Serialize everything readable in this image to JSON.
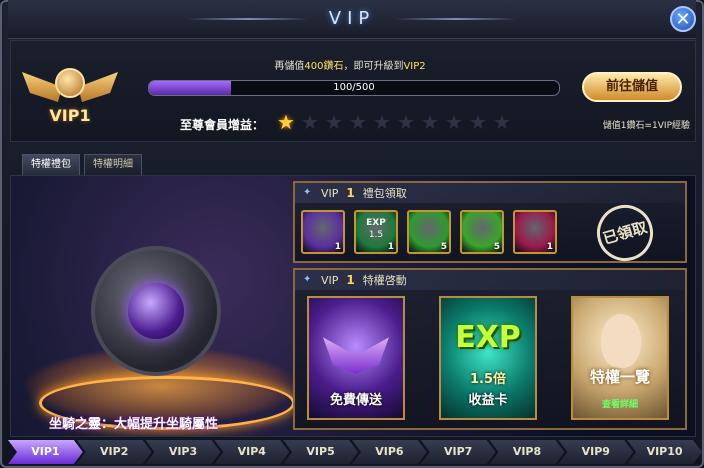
{
  "window": {
    "title": "VIP",
    "close_symbol": "✕"
  },
  "status": {
    "current_level": "VIP1",
    "hint_prefix": "再儲值",
    "hint_amount": "400鑽石",
    "hint_mid": "，即可升級到",
    "hint_target": "VIP2",
    "progress_text": "100/500",
    "progress_fraction": 0.2,
    "recharge_label": "前往儲值",
    "rate_note": "儲值1鑽石=1VIP經驗",
    "benefit_label": "至尊會員增益：",
    "stars_total": 10,
    "stars_lit": 1
  },
  "tabs": [
    {
      "label": "特權禮包",
      "active": true
    },
    {
      "label": "特權明細",
      "active": false
    }
  ],
  "stage": {
    "caption": "坐騎之靈：大幅提升坐騎屬性"
  },
  "gift_panel": {
    "prefix": "VIP",
    "level": "1",
    "suffix": "禮包領取",
    "items": [
      {
        "icon": "purple-orb-icon",
        "qty": "1",
        "color": "#5a2f9e"
      },
      {
        "icon": "exp-potion-icon",
        "qty": "1",
        "exp_text": "EXP",
        "mult": "1.5",
        "color": "#1f7a3a"
      },
      {
        "icon": "green-crystal-icon",
        "qty": "5",
        "color": "#2f9a2f"
      },
      {
        "icon": "green-arrow-upgrade-icon",
        "qty": "5",
        "color": "#3aa52a"
      },
      {
        "icon": "gold-coins-icon",
        "qty": "1",
        "color": "#9a1a4a"
      }
    ],
    "stamp_text": "已領取"
  },
  "perk_panel": {
    "prefix": "VIP",
    "level": "1",
    "suffix": "特權啓動",
    "cards": [
      {
        "label": "免費傳送"
      },
      {
        "big": "EXP",
        "mult": "1.5倍",
        "label": "收益卡"
      },
      {
        "label": "特權一覽",
        "sub": "查看詳細"
      }
    ]
  },
  "vip_tabs": [
    "VIP1",
    "VIP2",
    "VIP3",
    "VIP4",
    "VIP5",
    "VIP6",
    "VIP7",
    "VIP8",
    "VIP9",
    "VIP10"
  ],
  "vip_tabs_active": 0,
  "colors": {
    "accent_gold": "#ffd35a",
    "progress_purple": "#a46bff",
    "active_tab": "#6a2bd6"
  }
}
